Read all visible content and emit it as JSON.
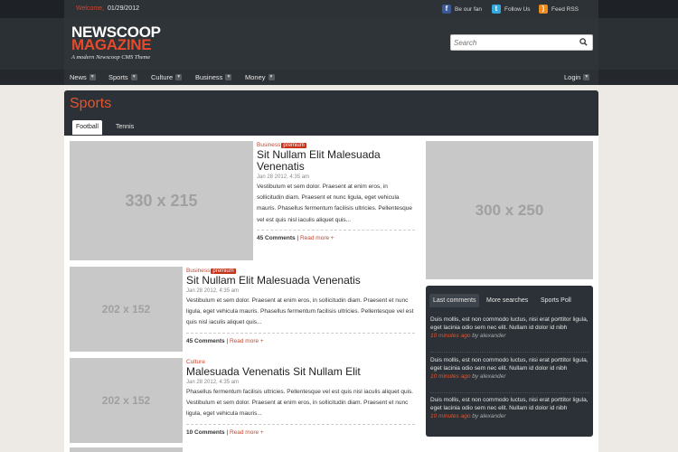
{
  "topbar": {
    "welcome_label": "Welcome,",
    "date": "01/29/2012",
    "social": [
      {
        "label": "Be our fan",
        "icon": "facebook-icon",
        "color": "#3b5998",
        "glyph": "f"
      },
      {
        "label": "Follow Us",
        "icon": "twitter-icon",
        "color": "#33a8dc",
        "glyph": "t"
      },
      {
        "label": "Feed RSS",
        "icon": "rss-icon",
        "color": "#ee8a1c",
        "glyph": ")"
      }
    ]
  },
  "header": {
    "logo_line1": "NEWSCOOP",
    "logo_line2": "MAGAZINE",
    "tagline": "A modern Newscoop CMS Theme",
    "search_placeholder": "Search"
  },
  "nav": {
    "items": [
      "News",
      "Sports",
      "Culture",
      "Business",
      "Money"
    ],
    "login": "Login"
  },
  "section": {
    "title": "Sports",
    "tabs": [
      "Football",
      "Tennis"
    ]
  },
  "placeholders": {
    "main": "330 x 215",
    "small1": "202 x 152",
    "small2": "202 x 152",
    "ad": "300 x 250"
  },
  "articles": [
    {
      "category": "Business",
      "badge": "premium",
      "title": "Sit Nullam Elit Malesuada Venenatis",
      "date": "Jan 28 2012, 4:35 am",
      "body": "Vestibulum et sem dolor. Praesent at enim eros, in sollicitudin diam. Praesent et nunc ligula, eget vehicula mauris. Phasellus fermentum facilisis ultricies. Pellentesque vel est quis nisl iaculis aliquet quis...",
      "comments": "45 Comments",
      "read_more": "Read more +"
    },
    {
      "category": "Business",
      "badge": "premium",
      "title": "Sit Nullam Elit Malesuada Venenatis",
      "date": "Jan 28 2012, 4:35 am",
      "body": "Vestibulum et sem dolor. Praesent at enim eros, in sollicitudin diam. Praesent et nunc ligula, eget vehicula mauris. Phasellus fermentum facilisis ultricies. Pellentesque vel est quis nisl iaculis aliquet quis...",
      "comments": "45 Comments",
      "read_more": "Read more +"
    },
    {
      "category": "Culture",
      "badge": "",
      "title": "Malesuada Venenatis Sit Nullam Elit",
      "date": "Jan 28 2012, 4:35 am",
      "body": "Phasellus fermentum facilisis ultricies. Pellentesque vel est quis nisl iaculis aliquet quis. Vestibulum et sem dolor. Praesent at enim eros, in sollicitudin diam. Praesent et nunc ligula, eget vehicula mauris...",
      "comments": "10 Comments",
      "read_more": "Read more +"
    }
  ],
  "separator": "|",
  "widget": {
    "tabs": [
      "Last comments",
      "More searches",
      "Sports Poll"
    ],
    "comments": [
      {
        "text": "Duis mollis, est non commodo luctus, nisi erat porttitor ligula, eget lacinia odio sem nec elit. Nullam id dolor id nibh",
        "ago": "10 minutes ago",
        "by": "by alexander"
      },
      {
        "text": "Duis mollis, est non commodo luctus, nisi erat porttitor ligula, eget lacinia odio sem nec elit. Nullam id dolor id nibh",
        "ago": "10 minutes ago",
        "by": "by alexander"
      },
      {
        "text": "Duis mollis, est non commodo luctus, nisi erat porttitor ligula, eget lacinia odio sem nec elit. Nullam id dolor id nibh",
        "ago": "10 minutes ago",
        "by": "by alexander"
      }
    ]
  },
  "colors": {
    "accent": "#e4552f",
    "dark": "#2b3136",
    "premium": "#c7321b"
  }
}
